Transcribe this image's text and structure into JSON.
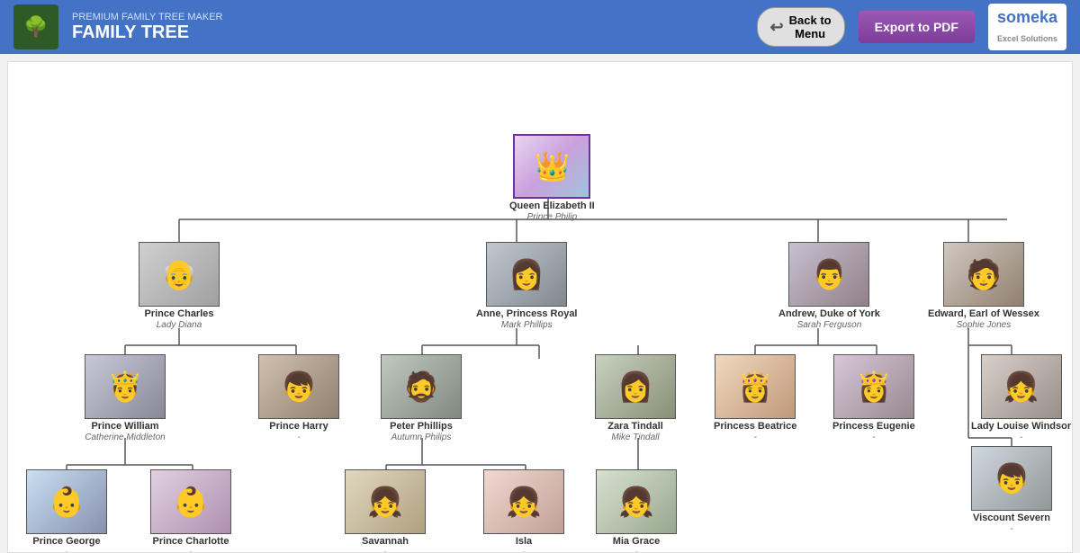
{
  "header": {
    "subtitle": "PREMIUM FAMILY TREE MAKER",
    "title": "FAMILY TREE",
    "back_label": "Back to\nMenu",
    "export_label": "Export to PDF",
    "brand": "someka",
    "brand_sub": "Excel Solutions"
  },
  "tree": {
    "root": {
      "name": "Queen Elizabeth II",
      "spouse": "Prince Philip"
    },
    "generation1": [
      {
        "name": "Prince Charles",
        "spouse": "Lady Diana"
      },
      {
        "name": "Anne, Princess Royal",
        "spouse": "Mark Phillips"
      },
      {
        "name": "Andrew, Duke of York",
        "spouse": "Sarah Ferguson"
      },
      {
        "name": "Edward, Earl of Wessex",
        "spouse": "Sophie Jones"
      }
    ],
    "generation2": [
      {
        "name": "Prince William",
        "spouse": "Catherine Middleton"
      },
      {
        "name": "Prince Harry",
        "spouse": "-"
      },
      {
        "name": "Peter Phillips",
        "spouse": "Autumn Philips"
      },
      {
        "name": "Zara Tindall",
        "spouse": "Mike Tindall"
      },
      {
        "name": "Princess Beatrice",
        "spouse": "-"
      },
      {
        "name": "Princess Eugenie",
        "spouse": "-"
      },
      {
        "name": "Lady Louise Windsor",
        "spouse": "-"
      },
      {
        "name": "Viscount Severn",
        "spouse": "-"
      }
    ],
    "generation3": [
      {
        "name": "Prince George",
        "spouse": "-"
      },
      {
        "name": "Prince Charlotte",
        "spouse": "-"
      },
      {
        "name": "Savannah",
        "spouse": "-"
      },
      {
        "name": "Isla",
        "spouse": "-"
      },
      {
        "name": "Mia Grace",
        "spouse": "-"
      }
    ]
  }
}
